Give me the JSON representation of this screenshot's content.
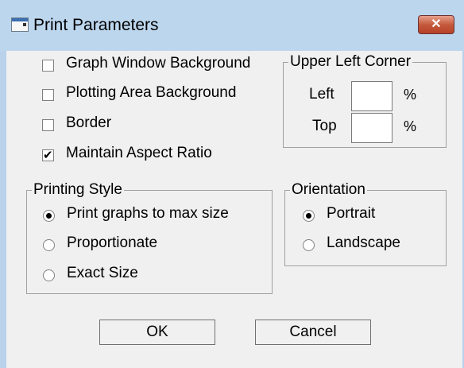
{
  "window": {
    "title": "Print Parameters",
    "close_label": "✕"
  },
  "checkboxes": [
    {
      "label": "Graph Window Background",
      "checked": false
    },
    {
      "label": "Plotting Area Background",
      "checked": false
    },
    {
      "label": "Border",
      "checked": false
    },
    {
      "label": "Maintain Aspect Ratio",
      "checked": true
    }
  ],
  "upper_left_corner": {
    "title": "Upper Left Corner",
    "left_label": "Left",
    "left_value": "",
    "top_label": "Top",
    "top_value": "",
    "unit": "%"
  },
  "printing_style": {
    "title": "Printing Style",
    "options": [
      {
        "label": "Print graphs to max size",
        "selected": true
      },
      {
        "label": "Proportionate",
        "selected": false
      },
      {
        "label": "Exact Size",
        "selected": false
      }
    ]
  },
  "orientation": {
    "title": "Orientation",
    "options": [
      {
        "label": "Portrait",
        "selected": true
      },
      {
        "label": "Landscape",
        "selected": false
      }
    ]
  },
  "buttons": {
    "ok": "OK",
    "cancel": "Cancel"
  }
}
